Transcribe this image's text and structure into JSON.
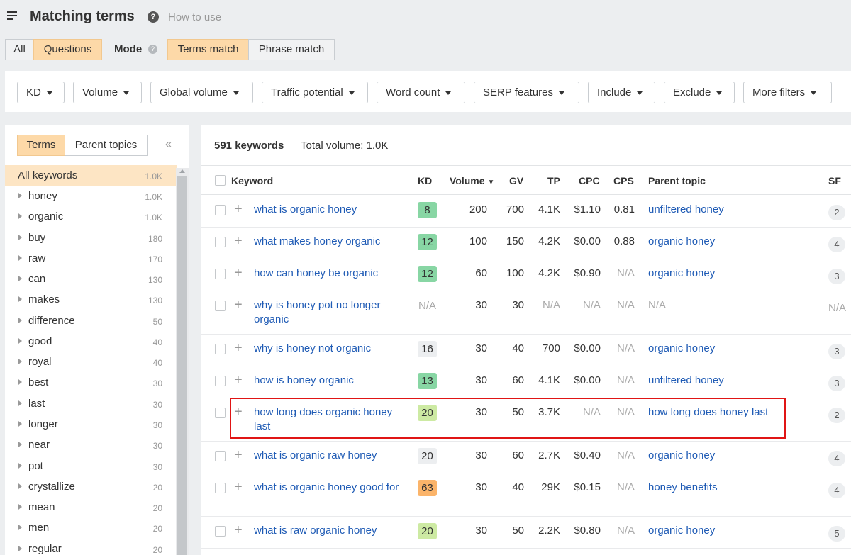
{
  "header": {
    "title": "Matching terms",
    "how_to_use": "How to use"
  },
  "mode_bar": {
    "all": "All",
    "questions": "Questions",
    "mode_label": "Mode",
    "terms_match": "Terms match",
    "phrase_match": "Phrase match"
  },
  "filters": [
    "KD",
    "Volume",
    "Global volume",
    "Traffic potential",
    "Word count",
    "SERP features",
    "Include",
    "Exclude",
    "More filters"
  ],
  "left_panel": {
    "tabs": {
      "terms": "Terms",
      "parent_topics": "Parent topics"
    },
    "collapse_icon": "double-chevron-left",
    "all": {
      "label": "All keywords",
      "count": "1.0K"
    },
    "items": [
      {
        "label": "honey",
        "count": "1.0K"
      },
      {
        "label": "organic",
        "count": "1.0K"
      },
      {
        "label": "buy",
        "count": "180"
      },
      {
        "label": "raw",
        "count": "170"
      },
      {
        "label": "can",
        "count": "130"
      },
      {
        "label": "makes",
        "count": "130"
      },
      {
        "label": "difference",
        "count": "50"
      },
      {
        "label": "good",
        "count": "40"
      },
      {
        "label": "royal",
        "count": "40"
      },
      {
        "label": "best",
        "count": "30"
      },
      {
        "label": "last",
        "count": "30"
      },
      {
        "label": "longer",
        "count": "30"
      },
      {
        "label": "near",
        "count": "30"
      },
      {
        "label": "pot",
        "count": "30"
      },
      {
        "label": "crystallize",
        "count": "20"
      },
      {
        "label": "mean",
        "count": "20"
      },
      {
        "label": "men",
        "count": "20"
      },
      {
        "label": "regular",
        "count": "20"
      }
    ]
  },
  "results": {
    "count": "591 keywords",
    "total_volume": "Total volume: 1.0K",
    "columns": {
      "keyword": "Keyword",
      "kd": "KD",
      "volume": "Volume",
      "gv": "GV",
      "tp": "TP",
      "cpc": "CPC",
      "cps": "CPS",
      "parent_topic": "Parent topic",
      "sf": "SF"
    },
    "rows": [
      {
        "keyword": "what is organic honey",
        "kd": "8",
        "volume": "200",
        "gv": "700",
        "tp": "4.1K",
        "cpc": "$1.10",
        "cps": "0.81",
        "parent_topic": "unfiltered honey",
        "sf": "2"
      },
      {
        "keyword": "what makes honey organic",
        "kd": "12",
        "volume": "100",
        "gv": "150",
        "tp": "4.2K",
        "cpc": "$0.00",
        "cps": "0.88",
        "parent_topic": "organic honey",
        "sf": "4"
      },
      {
        "keyword": "how can honey be organic",
        "kd": "12",
        "volume": "60",
        "gv": "100",
        "tp": "4.2K",
        "cpc": "$0.90",
        "cps": "N/A",
        "parent_topic": "organic honey",
        "sf": "3"
      },
      {
        "keyword": "why is honey pot no longer organic",
        "kd": "N/A",
        "volume": "30",
        "gv": "30",
        "tp": "N/A",
        "cpc": "N/A",
        "cps": "N/A",
        "parent_topic": "N/A",
        "sf": "N/A"
      },
      {
        "keyword": "why is honey not organic",
        "kd": "16",
        "volume": "30",
        "gv": "40",
        "tp": "700",
        "cpc": "$0.00",
        "cps": "N/A",
        "parent_topic": "organic honey",
        "sf": "3"
      },
      {
        "keyword": "how is honey organic",
        "kd": "13",
        "volume": "30",
        "gv": "60",
        "tp": "4.1K",
        "cpc": "$0.00",
        "cps": "N/A",
        "parent_topic": "unfiltered honey",
        "sf": "3"
      },
      {
        "keyword": "how long does organic honey last",
        "kd": "20",
        "volume": "30",
        "gv": "50",
        "tp": "3.7K",
        "cpc": "N/A",
        "cps": "N/A",
        "parent_topic": "how long does honey last",
        "sf": "2"
      },
      {
        "keyword": "what is organic raw honey",
        "kd": "20",
        "volume": "30",
        "gv": "60",
        "tp": "2.7K",
        "cpc": "$0.40",
        "cps": "N/A",
        "parent_topic": "organic honey",
        "sf": "4"
      },
      {
        "keyword": "what is organic honey good for",
        "kd": "63",
        "volume": "30",
        "gv": "40",
        "tp": "29K",
        "cpc": "$0.15",
        "cps": "N/A",
        "parent_topic": "honey benefits",
        "sf": "4"
      },
      {
        "keyword": "what is raw organic honey",
        "kd": "20",
        "volume": "30",
        "gv": "50",
        "tp": "2.2K",
        "cpc": "$0.80",
        "cps": "N/A",
        "parent_topic": "organic honey",
        "sf": "5"
      }
    ]
  },
  "colors": {
    "kd_green": "#88d6a4",
    "kd_light_green": "#cdeaa3",
    "kd_gray": "#eceef0",
    "kd_orange": "#fbb46a",
    "active_segment": "#fdd9a8",
    "link": "#1f5bb5",
    "highlight_border": "#e01515"
  }
}
